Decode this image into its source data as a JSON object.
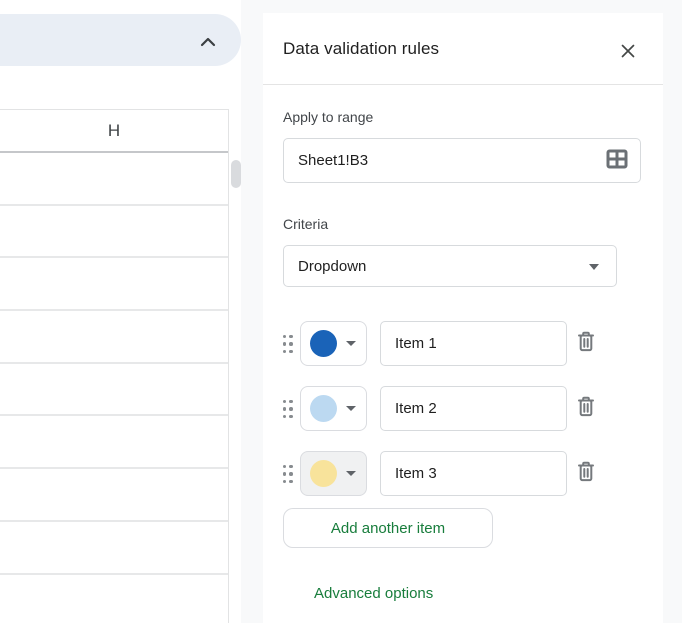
{
  "sheet": {
    "column_header": "H",
    "row_count": 9,
    "formula_bar_collapse_icon": "chevron-up-icon"
  },
  "panel": {
    "title": "Data validation rules",
    "close_icon": "close-x-icon",
    "apply_to_range": {
      "label": "Apply to range",
      "value": "Sheet1!B3",
      "icon": "select-data-range-grid-icon"
    },
    "criteria": {
      "label": "Criteria",
      "selected_option": "Dropdown",
      "dropdown_icon": "caret-down-icon"
    },
    "items": [
      {
        "label": "Item 1",
        "color": "#1a63b8",
        "chip_bg": "#ffffff",
        "icons": [
          "drag-handle-icon",
          "caret-down-icon",
          "trash-icon"
        ]
      },
      {
        "label": "Item 2",
        "color": "#bcd9f1",
        "chip_bg": "#ffffff",
        "icons": [
          "drag-handle-icon",
          "caret-down-icon",
          "trash-icon"
        ]
      },
      {
        "label": "Item 3",
        "color": "#f8e39b",
        "chip_bg": "#f0f1f2",
        "icons": [
          "drag-handle-icon",
          "caret-down-icon",
          "trash-icon"
        ]
      }
    ],
    "add_button_label": "Add another item",
    "advanced_options_label": "Advanced options"
  },
  "colors": {
    "accent_green": "#187d3c",
    "panel_background": "#ffffff",
    "page_background": "#f8f9fa",
    "formula_bar": "#e9eef5",
    "border_gray": "#dadce0",
    "icon_gray": "#75797d"
  }
}
